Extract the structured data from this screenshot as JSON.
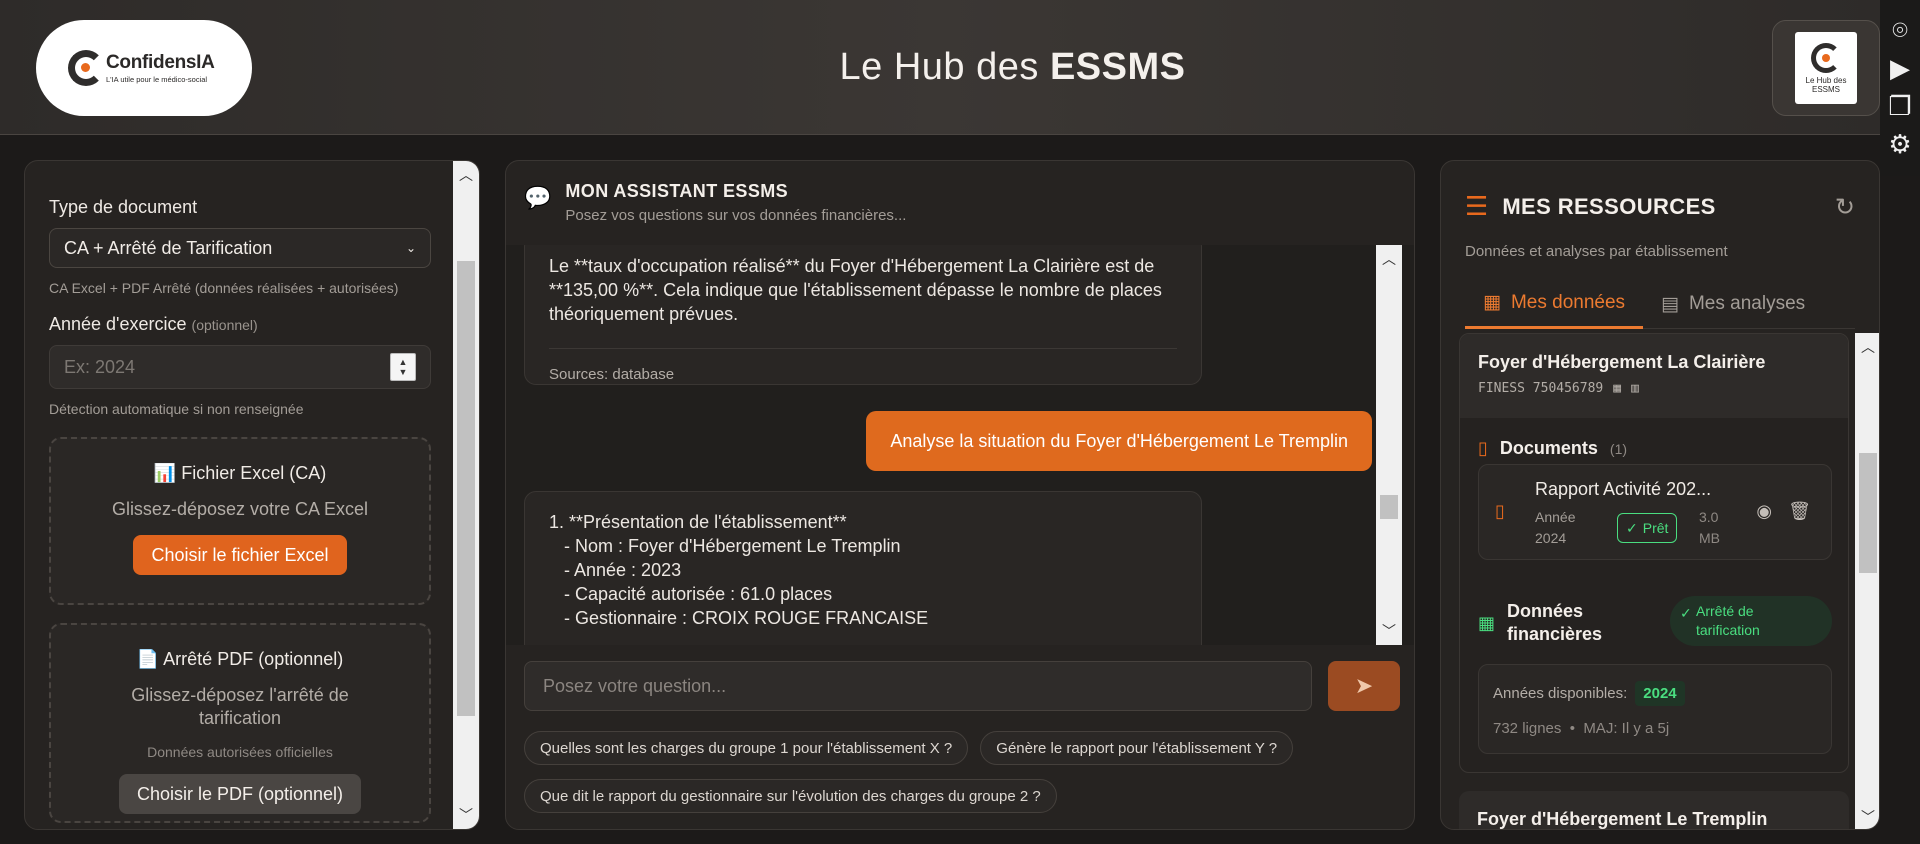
{
  "header": {
    "logo_name": "ConfidensIA",
    "logo_tagline": "L'IA utile pour le médico-social",
    "title_regular": "Le Hub des ",
    "title_bold": "ESSMS",
    "hub_badge_text": "Le Hub des ESSMS"
  },
  "side_toolbar": {
    "icons": [
      "camera-icon",
      "video-icon",
      "window-icon",
      "gear-icon"
    ]
  },
  "left_panel": {
    "doc_type_label": "Type de document",
    "doc_type_value": "CA + Arrêté de Tarification",
    "doc_type_hint": "CA Excel + PDF Arrêté (données réalisées + autorisées)",
    "year_label": "Année d'exercice",
    "year_optional": "(optionnel)",
    "year_placeholder": "Ex: 2024",
    "year_hint": "Détection automatique si non renseignée",
    "excel": {
      "title": "📊 Fichier Excel (CA)",
      "subtitle": "Glissez-déposez votre CA Excel",
      "button": "Choisir le fichier Excel"
    },
    "pdf": {
      "title": "📄 Arrêté PDF (optionnel)",
      "subtitle": "Glissez-déposez l'arrêté de tarification",
      "hint": "Données autorisées officielles",
      "button": "Choisir le PDF (optionnel)"
    }
  },
  "chat": {
    "title": "MON ASSISTANT ESSMS",
    "subtitle": "Posez vos questions sur vos données financières...",
    "messages": {
      "bot1_text": "Le **taux d'occupation réalisé** du Foyer d'Hébergement La Clairière est de **135,00 %**. Cela indique que l'établissement dépasse le nombre de places théoriquement prévues.",
      "bot1_sources": "Sources: database",
      "user1_text": "Analyse la situation du Foyer d'Hébergement Le Tremplin",
      "bot2_lines": [
        "1. **Présentation de l'établissement**",
        "   - Nom : Foyer d'Hébergement Le Tremplin",
        "   - Année : 2023",
        "   - Capacité autorisée : 61.0 places",
        "   - Gestionnaire : CROIX ROUGE FRANCAISE"
      ]
    },
    "input_placeholder": "Posez votre question...",
    "suggestions": [
      "Quelles sont les charges du groupe 1 pour l'établissement X ?",
      "Génère le rapport pour l'établissement Y ?",
      "Que dit le rapport du gestionnaire sur l'évolution des charges du groupe 2 ?"
    ]
  },
  "resources": {
    "title": "MES RESSOURCES",
    "subtitle": "Données et analyses par établissement",
    "tabs": [
      {
        "label": "Mes données",
        "active": true
      },
      {
        "label": "Mes analyses",
        "active": false
      }
    ],
    "establishment": {
      "name": "Foyer d'Hébergement La Clairière",
      "finess": "FINESS 750456789",
      "documents_label": "Documents",
      "documents_count": "(1)",
      "document": {
        "name": "Rapport Activité 202...",
        "year_label": "Année",
        "year_value": "2024",
        "status": "Prêt",
        "size_value": "3.0",
        "size_unit": "MB"
      },
      "financial_label_line1": "Données",
      "financial_label_line2": "financières",
      "financial_badge_line1": "Arrêté de",
      "financial_badge_line2": "tarification",
      "years_label": "Années disponibles:",
      "years_value": "2024",
      "rows": "732 lignes",
      "updated": "MAJ: Il y a 5j"
    },
    "next_establishment": "Foyer d'Hébergement Le Tremplin"
  },
  "colors": {
    "accent": "#e0641e",
    "success": "#4ade80",
    "background": "#1c1a19",
    "panel": "#262321"
  }
}
